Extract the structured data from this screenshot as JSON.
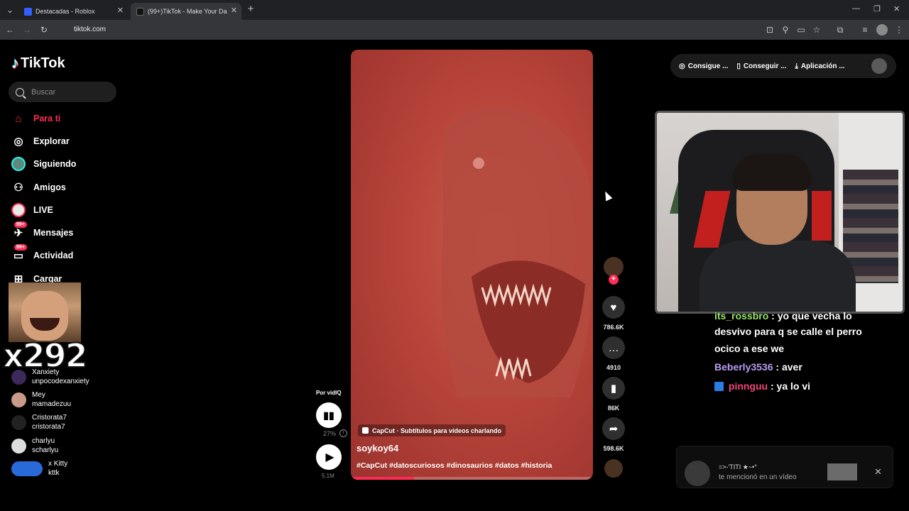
{
  "browser": {
    "tabs": [
      {
        "label": "Destacadas - Roblox"
      },
      {
        "label": "(99+)TikTok - Make Your Da"
      }
    ],
    "url": "tiktok.com",
    "new_tab": "+",
    "close_glyph": "✕"
  },
  "sidebar": {
    "logo": "TikTok",
    "search_placeholder": "Buscar",
    "nav": [
      {
        "label": "Para ti",
        "icon": "home-icon",
        "active": true
      },
      {
        "label": "Explorar",
        "icon": "compass-icon"
      },
      {
        "label": "Siguiendo",
        "icon": "following-avatar-icon"
      },
      {
        "label": "Amigos",
        "icon": "friends-icon"
      },
      {
        "label": "LIVE",
        "icon": "live-icon"
      },
      {
        "label": "Mensajes",
        "icon": "message-icon",
        "badge": "99+"
      },
      {
        "label": "Actividad",
        "icon": "activity-icon",
        "badge": "99+"
      },
      {
        "label": "Cargar",
        "icon": "upload-icon"
      }
    ],
    "overlay_counter": "x292",
    "following_accounts": [
      {
        "name": "Xanxiety",
        "handle": "unpocodexanxiety"
      },
      {
        "name": "Mey",
        "handle": "mamadezuu"
      },
      {
        "name": "Cristorata7",
        "handle": "cristorata7"
      },
      {
        "name": "charlyu",
        "handle": "scharlyu"
      },
      {
        "name": "x Kitty",
        "handle": "kttk"
      }
    ]
  },
  "player": {
    "speed_label": "Por vidIQ",
    "speed_pct": "27%",
    "views": "5.1M",
    "progress": 0.26,
    "capcut_label": "CapCut · Subtítulos para vídeos charlando",
    "author": "soykoy64",
    "hashtags": "#CapCut #datoscuriosos #dinosaurios #datos #historia"
  },
  "actions": {
    "likes": "786.6K",
    "comments": "4910",
    "saves": "86K",
    "shares": "598.6K",
    "follow_plus": "+"
  },
  "topbar": {
    "pill1": "Consigue ...",
    "pill2": "Conseguir ...",
    "pill3": "Aplicación ..."
  },
  "chat": [
    {
      "user": "its_rossbro",
      "text": ": yo que vecha lo"
    },
    {
      "text": "desvivo para q se calle el perro"
    },
    {
      "text": "ocico a ese we"
    },
    {
      "user": "Beberly3536",
      "text": ": aver"
    },
    {
      "user": "pinnguu",
      "text": ": ya lo vi"
    }
  ],
  "notification": {
    "title": "=>-'TITI ★~•°",
    "message": "te mencionó en un vídeo",
    "close_glyph": "✕"
  },
  "colors": {
    "accent": "#fe2c55",
    "video_red": "#b8453a",
    "chat_purple": "#b99cf2",
    "chat_pink": "#f0467a"
  }
}
